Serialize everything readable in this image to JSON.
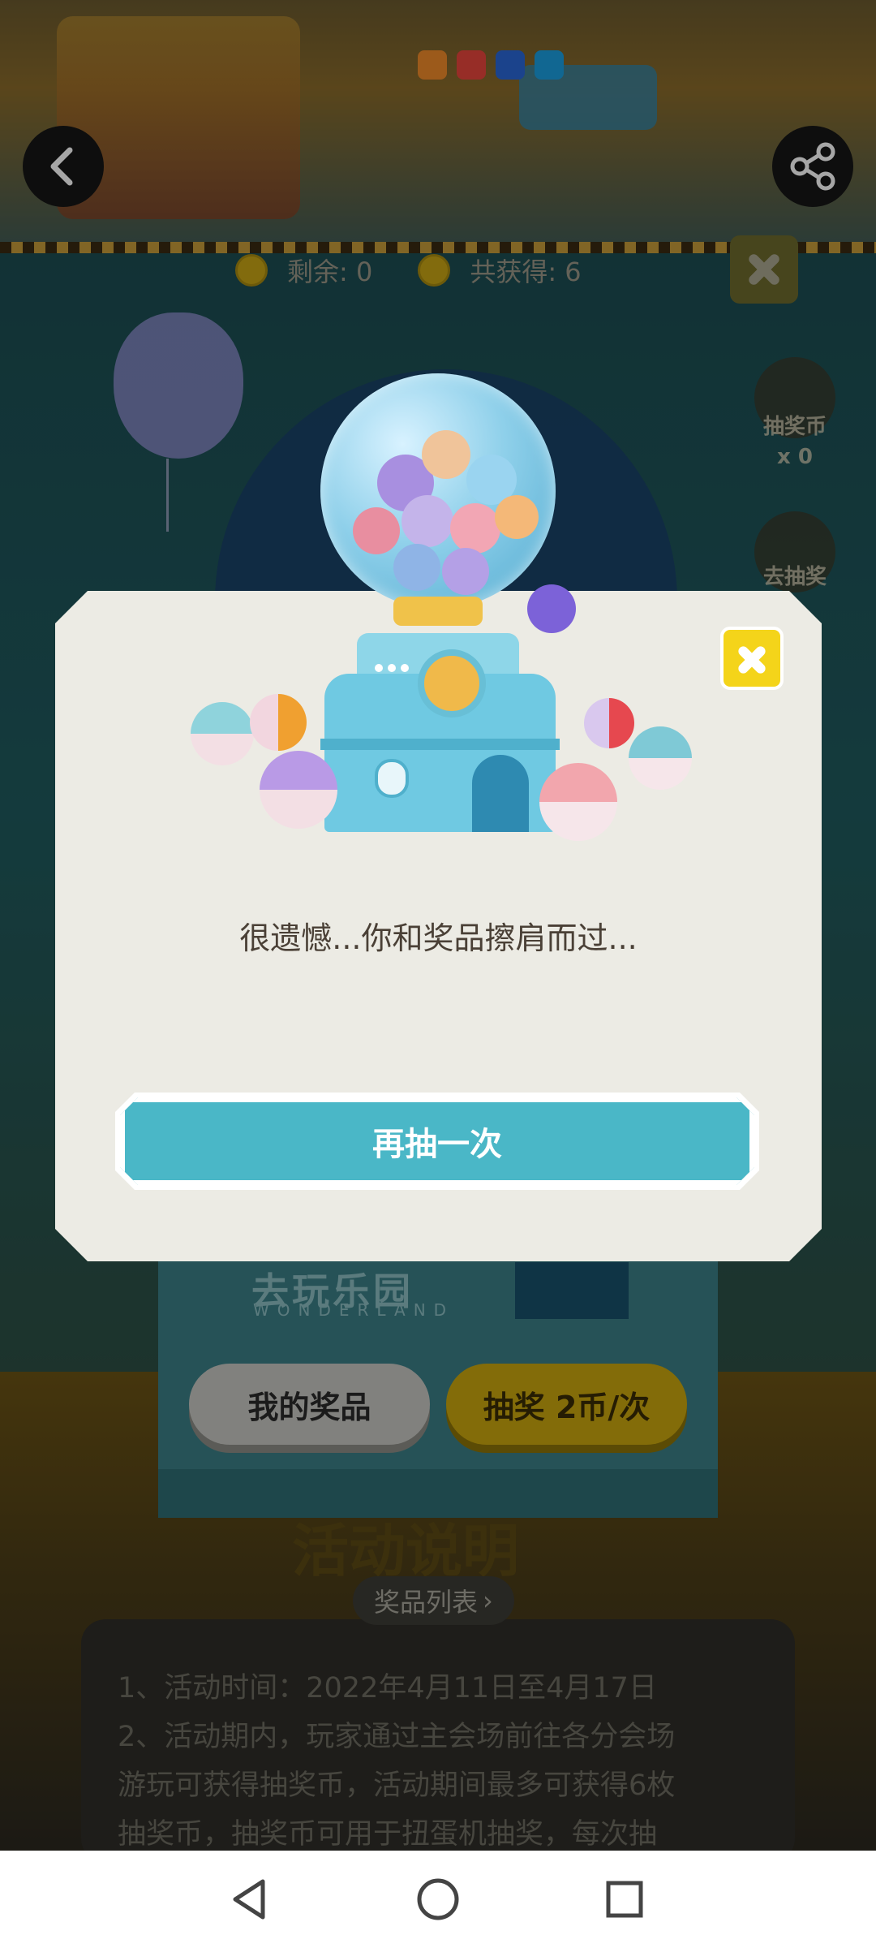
{
  "header": {
    "stats": {
      "remaining_label": "剩余: 0",
      "total_label": "共获得: 6"
    }
  },
  "side_panel": {
    "coins_label": "抽奖币",
    "coins_count": "x 0",
    "go_draw_label": "去抽奖"
  },
  "modal": {
    "message": "很遗憾...你和奖品擦肩而过...",
    "retry_label": "再抽一次"
  },
  "machine": {
    "logo": "去玩乐园",
    "logo_sub": "WONDERLAND",
    "my_prizes_label": "我的奖品",
    "draw_label": "抽奖 2币/次"
  },
  "rules": {
    "title": "活动说明",
    "prize_list_label": "奖品列表",
    "lines": [
      "1、活动时间：2022年4月11日至4月17日",
      "2、活动期内，玩家通过主会场前往各分会场",
      "游玩可获得抽奖币，活动期间最多可获得6枚",
      "抽奖币，抽奖币可用于扭蛋机抽奖，每次抽"
    ]
  },
  "colors": {
    "accent_teal": "#4ab7c7",
    "accent_yellow": "#f4d41a",
    "modal_bg": "#ecebe4"
  },
  "icons": [
    "back-icon",
    "share-icon",
    "close-icon",
    "coin-icon",
    "nav-back-icon",
    "nav-home-icon",
    "nav-recents-icon"
  ]
}
